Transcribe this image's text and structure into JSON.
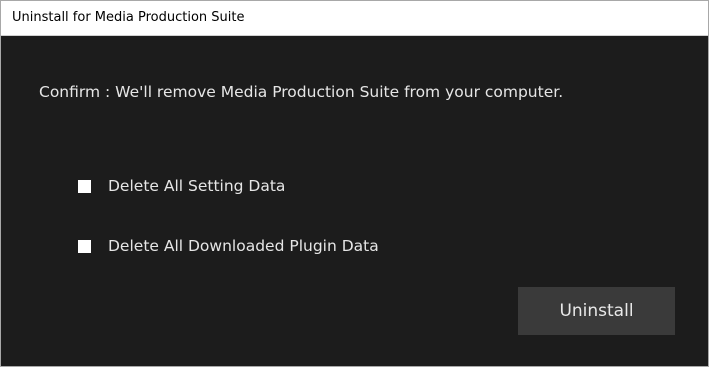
{
  "window": {
    "title": "Uninstall for Media Production Suite"
  },
  "dialog": {
    "confirm_text": "Confirm : We'll remove Media Production Suite from your computer.",
    "options": [
      {
        "label": "Delete All Setting Data",
        "checked": false
      },
      {
        "label": "Delete All Downloaded Plugin Data",
        "checked": false
      }
    ],
    "uninstall_label": "Uninstall"
  },
  "colors": {
    "background": "#1c1c1c",
    "titlebar": "#ffffff",
    "text": "#e6e6e6",
    "button": "#3a3a3a"
  }
}
